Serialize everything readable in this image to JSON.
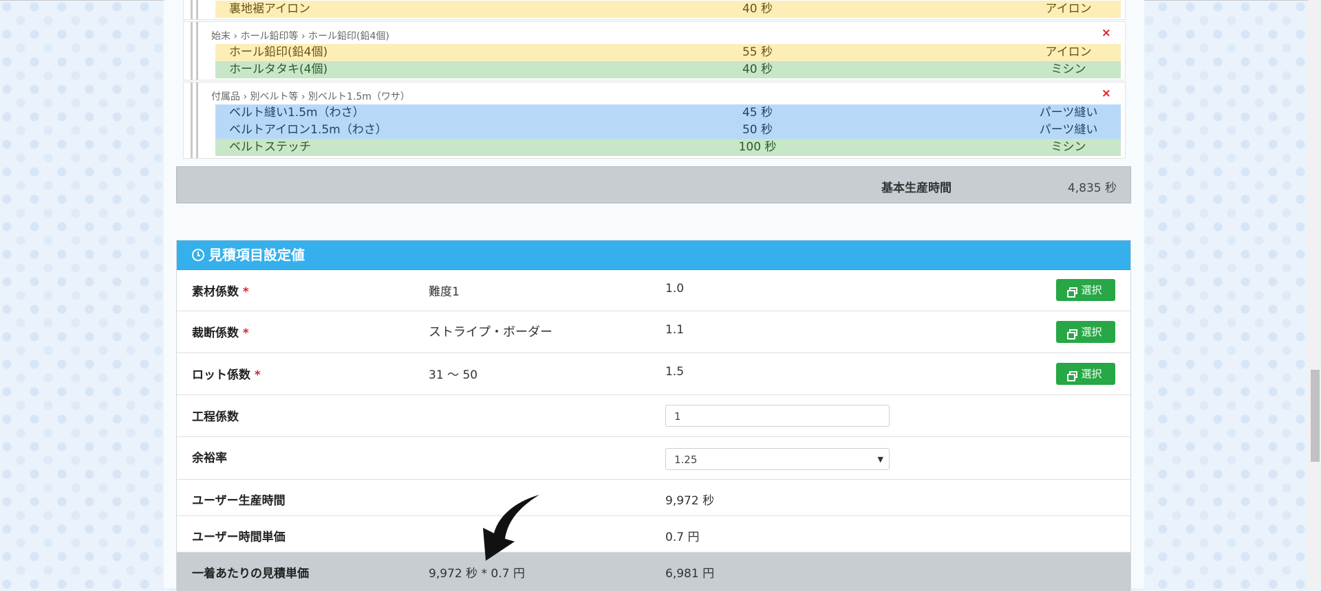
{
  "groups": [
    {
      "path": "",
      "rows": [
        {
          "name": "裏地裾アイロン",
          "time": "40 秒",
          "type": "アイロン",
          "color": "yellow"
        }
      ]
    },
    {
      "path": "始末 › ホール鉛印等 › ホール鉛印(鉛4個)",
      "rows": [
        {
          "name": "ホール鉛印(鉛4個)",
          "time": "55 秒",
          "type": "アイロン",
          "color": "yellow"
        },
        {
          "name": "ホールタタキ(4個)",
          "time": "40 秒",
          "type": "ミシン",
          "color": "green"
        }
      ]
    },
    {
      "path": "付属品 › 別ベルト等 › 別ベルト1.5m（ワサ）",
      "rows": [
        {
          "name": "ベルト縫い1.5m（わさ）",
          "time": "45 秒",
          "type": "パーツ縫い",
          "color": "blue"
        },
        {
          "name": "ベルトアイロン1.5m（わさ）",
          "time": "50 秒",
          "type": "パーツ縫い",
          "color": "blue"
        },
        {
          "name": "ベルトステッチ",
          "time": "100 秒",
          "type": "ミシン",
          "color": "green"
        }
      ]
    }
  ],
  "delete_icon": "×",
  "total": {
    "label": "基本生産時間",
    "value": "4,835 秒"
  },
  "panel": {
    "title": "見積項目設定値",
    "required_mark": "*",
    "select_button": "選択",
    "fields": {
      "material": {
        "label": "素材係数",
        "value1": "難度1",
        "value2": "1.0"
      },
      "cutting": {
        "label": "裁断係数",
        "value1": "ストライプ・ボーダー",
        "value2": "1.1"
      },
      "lot": {
        "label": "ロット係数",
        "value1": "31 ～ 50",
        "value2": "1.5"
      },
      "process": {
        "label": "工程係数",
        "input_value": "1"
      },
      "margin": {
        "label": "余裕率",
        "selected": "1.25"
      },
      "user_time": {
        "label": "ユーザー生産時間",
        "value2": "9,972 秒"
      },
      "user_unit": {
        "label": "ユーザー時間単価",
        "value2": "0.7 円"
      },
      "estimate": {
        "label": "一着あたりの見積単価",
        "value1": "9,972 秒 * 0.7 円",
        "value2": "6,981 円"
      }
    }
  },
  "colors": {
    "header": "#35b0ec",
    "select_button": "#27a745",
    "yellow": "#fdeeb7",
    "green": "#c8e6c8",
    "blue": "#b8d8f7"
  }
}
